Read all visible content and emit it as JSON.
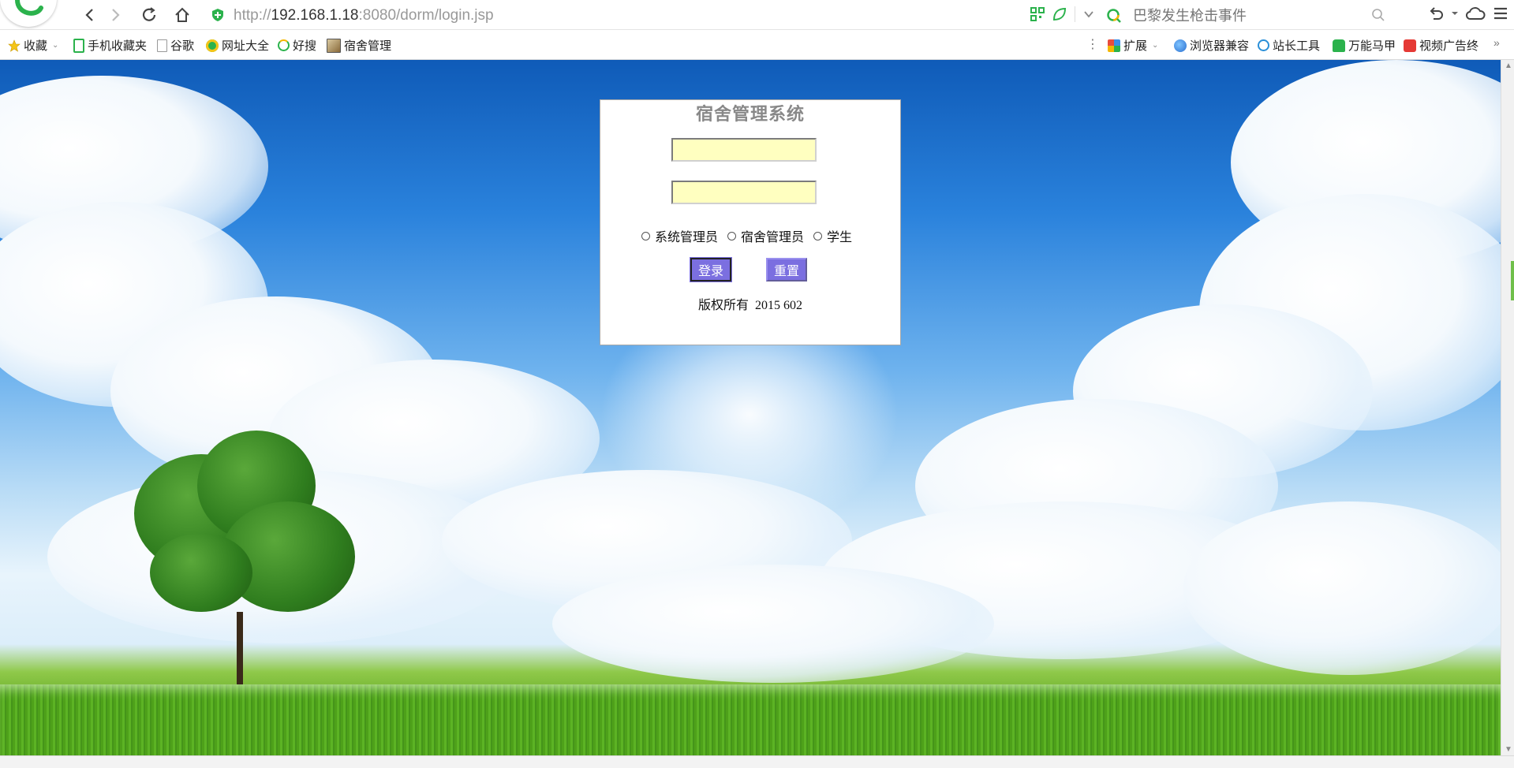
{
  "browser": {
    "url_scheme": "http://",
    "url_host": "192.168.1.18",
    "url_rest": ":8080/dorm/login.jsp",
    "search_placeholder": "巴黎发生枪击事件",
    "accent": "#2bb24c"
  },
  "bookmarks": {
    "favorites_label": "收藏",
    "items": [
      {
        "label": "手机收藏夹",
        "icon": "mobile-icon"
      },
      {
        "label": "谷歌",
        "icon": "page-icon"
      },
      {
        "label": "网址大全",
        "icon": "url-directory-icon"
      },
      {
        "label": "好搜",
        "icon": "haosou-icon"
      },
      {
        "label": "宿舍管理",
        "icon": "image-page-icon"
      }
    ],
    "right_items": [
      {
        "label": "扩展",
        "icon": "extension-icon"
      },
      {
        "label": "浏览器兼容",
        "icon": "compat-icon"
      },
      {
        "label": "站长工具",
        "icon": "webmaster-icon"
      },
      {
        "label": "万能马甲",
        "icon": "vest-icon"
      },
      {
        "label": "视频广告终",
        "icon": "video-ad-icon"
      }
    ]
  },
  "login": {
    "title": "宿舍管理系统",
    "username_value": "",
    "password_value": "",
    "roles": [
      "系统管理员",
      "宿舍管理员",
      "学生"
    ],
    "login_label": "登录",
    "reset_label": "重置",
    "copyright": "版权所有  2015 602",
    "field_color": "#ffffc0",
    "button_color": "#7b6fe0"
  }
}
